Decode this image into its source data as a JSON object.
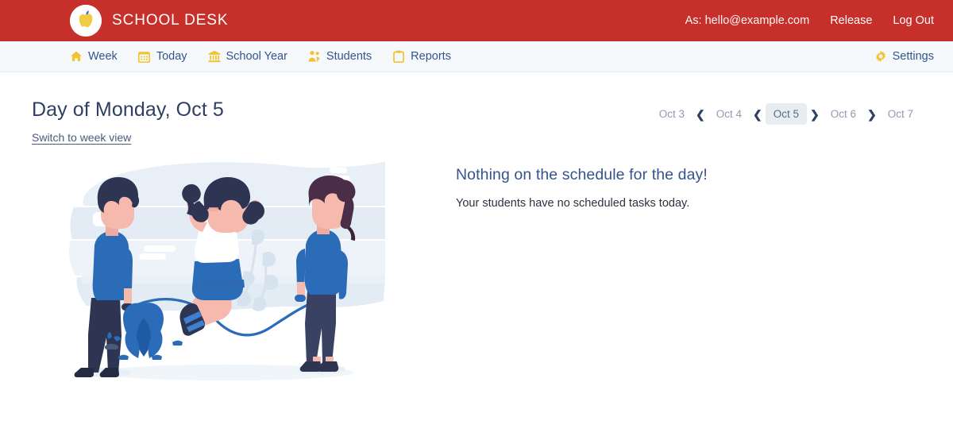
{
  "header": {
    "brand_name": "SCHOOL DESK",
    "logo_icon": "apple-logo-icon",
    "user_label": "As: hello@example.com",
    "release_label": "Release",
    "logout_label": "Log Out"
  },
  "nav": {
    "items": [
      {
        "label": "Week",
        "icon": "home-icon"
      },
      {
        "label": "Today",
        "icon": "calendar-icon"
      },
      {
        "label": "School Year",
        "icon": "bank-icon"
      },
      {
        "label": "Students",
        "icon": "users-icon"
      },
      {
        "label": "Reports",
        "icon": "clipboard-icon"
      }
    ],
    "settings": {
      "label": "Settings",
      "icon": "gear-icon"
    }
  },
  "page": {
    "title": "Day of Monday, Oct 5",
    "switch_link": "Switch to week view"
  },
  "datepager": {
    "dates": [
      {
        "label": "Oct 3",
        "active": false
      },
      {
        "label": "Oct 4",
        "active": false
      },
      {
        "label": "Oct 5",
        "active": true
      },
      {
        "label": "Oct 6",
        "active": false
      },
      {
        "label": "Oct 7",
        "active": false
      }
    ],
    "prev_icon": "chevron-left-icon",
    "next_icon": "chevron-right-icon",
    "chev_left": "❮",
    "chev_right": "❯"
  },
  "empty_state": {
    "illustration": "kids-jumping-rope-illustration",
    "heading": "Nothing on the schedule for the day!",
    "subtext": "Your students have no scheduled tasks today."
  },
  "colors": {
    "header_red": "#c62f2a",
    "nav_bg": "#f6f9fb",
    "nav_text_blue": "#33548c",
    "icon_gold": "#f2c230",
    "title_navy": "#2e3f63",
    "chip_active_bg": "#e8edf2",
    "muted_text": "#8e9bb3",
    "illus_blue": "#1d6fc4",
    "illus_navy": "#2e3552",
    "illus_light": "#e3ebf4",
    "illus_skin": "#f6b9ae"
  }
}
